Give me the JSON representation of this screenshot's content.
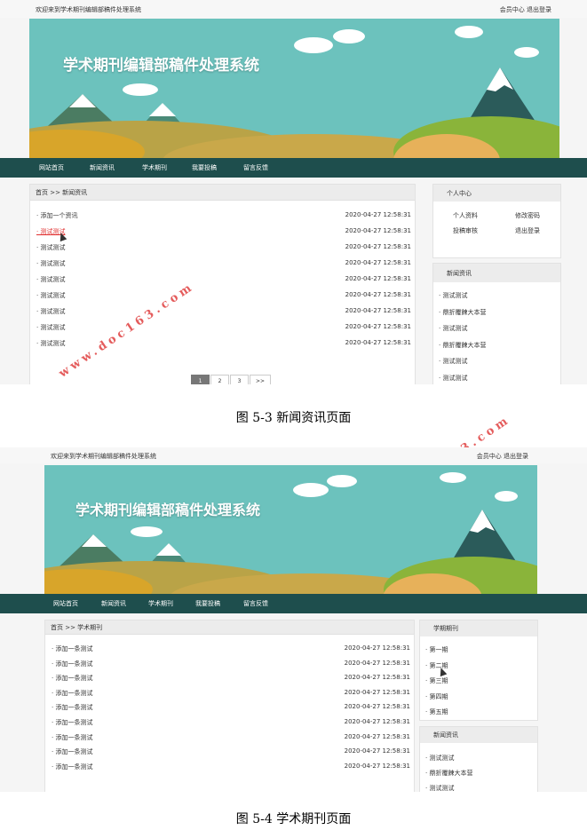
{
  "site": {
    "welcome": "欢迎来到学术期刊编辑部稿件处理系统",
    "user_links": "会员中心 退出登录",
    "banner_title": "学术期刊编辑部稿件处理系统",
    "nav": [
      "网站首页",
      "新闻资讯",
      "学术期刊",
      "我要投稿",
      "留言反馈"
    ]
  },
  "screen1": {
    "breadcrumb": "首页 >> 新闻资讯",
    "rows": [
      {
        "title": "· 添加一个资讯",
        "date": "2020-04-27 12:58:31"
      },
      {
        "title": "· 测试测试",
        "date": "2020-04-27 12:58:31"
      },
      {
        "title": "· 测试测试",
        "date": "2020-04-27 12:58:31"
      },
      {
        "title": "· 测试测试",
        "date": "2020-04-27 12:58:31"
      },
      {
        "title": "· 测试测试",
        "date": "2020-04-27 12:58:31"
      },
      {
        "title": "· 测试测试",
        "date": "2020-04-27 12:58:31"
      },
      {
        "title": "· 测试测试",
        "date": "2020-04-27 12:58:31"
      },
      {
        "title": "· 测试测试",
        "date": "2020-04-27 12:58:31"
      },
      {
        "title": "· 测试测试",
        "date": "2020-04-27 12:58:31"
      }
    ],
    "pagination": [
      "1",
      "2",
      "3",
      ">>"
    ],
    "member_center": {
      "title": "个人中心",
      "links": [
        "个人资料",
        "修改密码",
        "投稿审核",
        "退出登录"
      ]
    },
    "news_sidebar": {
      "title": "新闻资讯",
      "items": [
        "· 测试测试",
        "· 鼎折覆餗大本营",
        "· 测试测试",
        "· 鼎折覆餗大本营",
        "· 测试测试",
        "· 测试测试"
      ]
    }
  },
  "caption1": "图 5-3 新闻资讯页面",
  "screen2": {
    "breadcrumb": "首页 >> 学术期刊",
    "rows": [
      {
        "title": "· 添加一条测试",
        "date": "2020-04-27 12:58:31"
      },
      {
        "title": "· 添加一条测试",
        "date": "2020-04-27 12:58:31"
      },
      {
        "title": "· 添加一条测试",
        "date": "2020-04-27 12:58:31"
      },
      {
        "title": "· 添加一条测试",
        "date": "2020-04-27 12:58:31"
      },
      {
        "title": "· 添加一条测试",
        "date": "2020-04-27 12:58:31"
      },
      {
        "title": "· 添加一条测试",
        "date": "2020-04-27 12:58:31"
      },
      {
        "title": "· 添加一条测试",
        "date": "2020-04-27 12:58:31"
      },
      {
        "title": "· 添加一条测试",
        "date": "2020-04-27 12:58:31"
      },
      {
        "title": "· 添加一条测试",
        "date": "2020-04-27 12:58:31"
      }
    ],
    "issues_sidebar": {
      "title": "学期期刊",
      "items": [
        "· 第一期",
        "· 第二期",
        "· 第三期",
        "· 第四期",
        "· 第五期"
      ]
    },
    "news_sidebar": {
      "title": "新闻资讯",
      "items": [
        "· 测试测试",
        "· 鼎折覆餗大本营",
        "· 测试测试"
      ]
    }
  },
  "caption2": "图 5-4 学术期刊页面",
  "watermark": "www.doc163.com",
  "colors": {
    "nav": "#1e4e4d",
    "sky": "#6cc2bd",
    "highlight": "#e03030"
  }
}
